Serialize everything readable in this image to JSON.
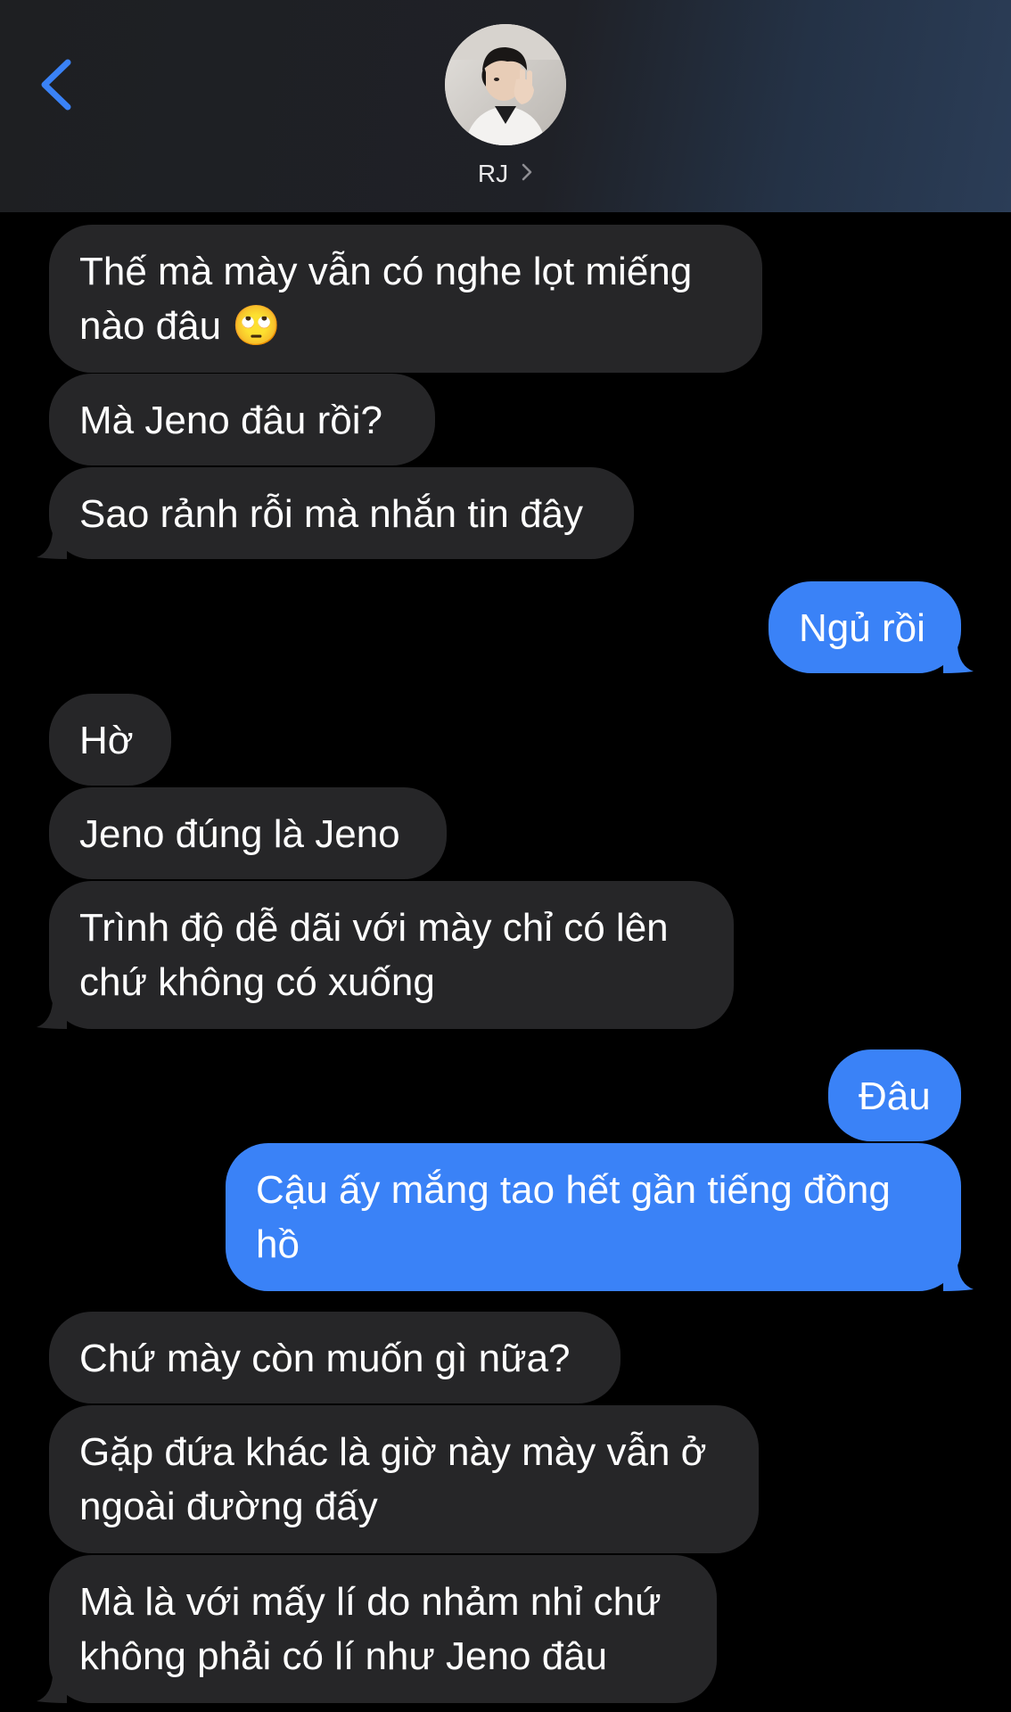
{
  "header": {
    "contact_name": "RJ",
    "back_icon": "chevron-left-icon",
    "details_icon": "chevron-right-icon"
  },
  "colors": {
    "incoming_bubble": "#262628",
    "outgoing_bubble": "#3a82f7",
    "accent": "#3a82f7",
    "background": "#000000"
  },
  "messages": [
    {
      "direction": "incoming",
      "lines": [
        "Thế mà mày vẫn có nghe lọt miếng",
        "nào đâu 🙄"
      ]
    },
    {
      "direction": "incoming",
      "lines": [
        "Mà Jeno đâu rồi?"
      ]
    },
    {
      "direction": "incoming",
      "lines": [
        "Sao rảnh rỗi mà nhắn tin đây"
      ]
    },
    {
      "direction": "outgoing",
      "lines": [
        "Ngủ rồi"
      ]
    },
    {
      "direction": "incoming",
      "lines": [
        "Hờ"
      ]
    },
    {
      "direction": "incoming",
      "lines": [
        "Jeno đúng là Jeno"
      ]
    },
    {
      "direction": "incoming",
      "lines": [
        "Trình độ dễ dãi với mày chỉ có lên",
        "chứ không có xuống"
      ]
    },
    {
      "direction": "outgoing",
      "lines": [
        "Đâu"
      ]
    },
    {
      "direction": "outgoing",
      "lines": [
        "Cậu ấy mắng tao hết gần tiếng đồng",
        "hồ"
      ]
    },
    {
      "direction": "incoming",
      "lines": [
        "Chứ mày còn muốn gì nữa?"
      ]
    },
    {
      "direction": "incoming",
      "lines": [
        "Gặp đứa khác là giờ này mày vẫn ở",
        "ngoài đường đấy"
      ]
    },
    {
      "direction": "incoming",
      "lines": [
        "Mà là với mấy lí do nhảm nhỉ chứ",
        "không phải có lí như Jeno đâu"
      ]
    }
  ]
}
